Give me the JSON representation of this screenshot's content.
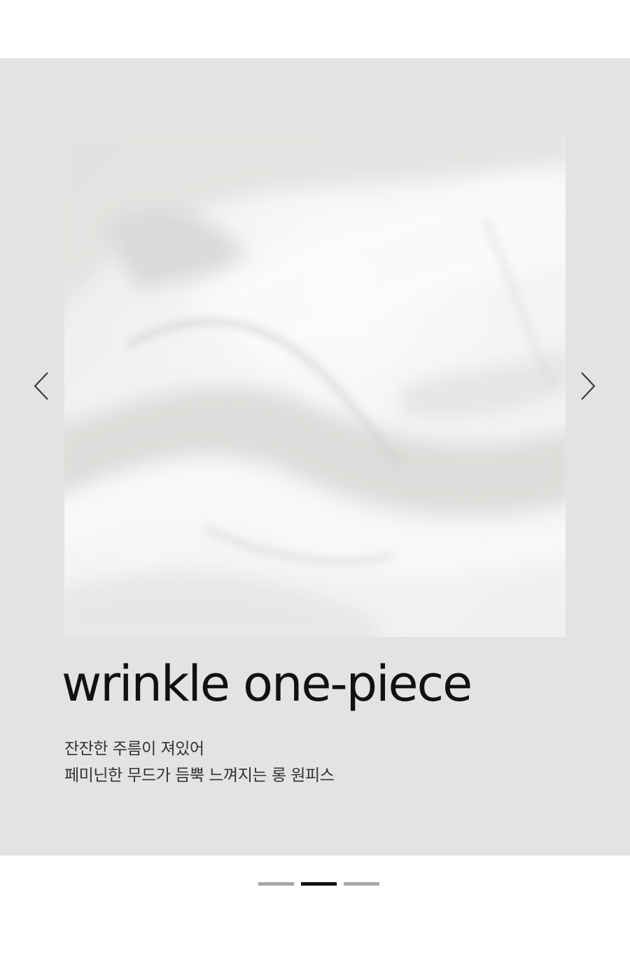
{
  "slide": {
    "title": "wrinkle one-piece",
    "description": [
      "잔잔한 주름이 져있어",
      "페미닌한 무드가 듬뿍 느껴지는 롱 원피스"
    ],
    "image_label": "white wrinkled fabric close-up"
  },
  "navigation": {
    "prev_icon": "chevron-left-icon",
    "next_icon": "chevron-right-icon"
  },
  "pagination": {
    "total": 3,
    "active_index": 1
  },
  "colors": {
    "slider_background": "#e3e3e3",
    "text": "#111111",
    "dot_inactive": "#a8a8a8",
    "dot_active": "#111111"
  }
}
